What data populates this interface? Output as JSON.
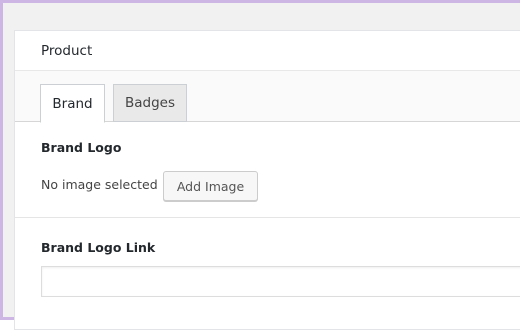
{
  "panel": {
    "title": "Product"
  },
  "tabs": [
    {
      "label": "Brand",
      "active": true
    },
    {
      "label": "Badges",
      "active": false
    }
  ],
  "brand_logo": {
    "label": "Brand Logo",
    "status_text": "No image selected",
    "button_label": "Add Image"
  },
  "brand_logo_link": {
    "label": "Brand Logo Link",
    "value": ""
  },
  "colors": {
    "frame_border": "#cdb6e4",
    "background": "#f1f1f1",
    "panel": "#ffffff"
  }
}
